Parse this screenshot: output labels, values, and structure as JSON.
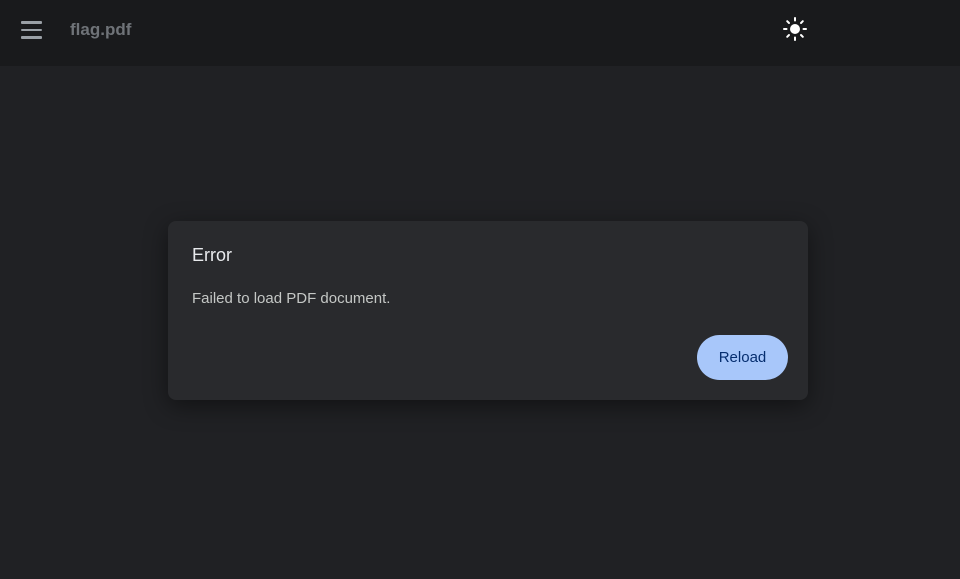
{
  "toolbar": {
    "menu_icon": "hamburger-menu-icon",
    "title": "flag.pdf",
    "theme_icon": "sun-icon"
  },
  "dialog": {
    "title": "Error",
    "message": "Failed to load PDF document.",
    "reload_label": "Reload"
  },
  "colors": {
    "background": "#202124",
    "toolbar": "#191a1c",
    "dialog": "#292a2d",
    "button": "#a8c7fa",
    "button_text": "#062e6f"
  }
}
